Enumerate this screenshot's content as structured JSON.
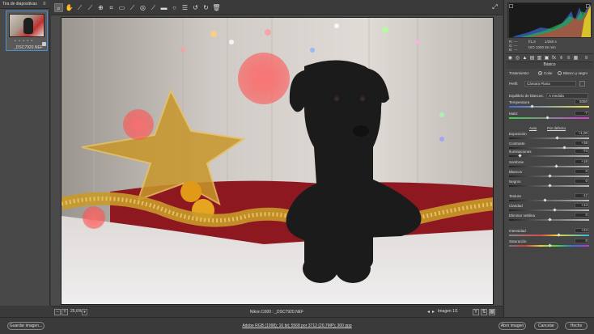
{
  "filmstrip": {
    "title": "Tira de diapositivas",
    "thumb_rating": "• • • • •",
    "thumb_name": "_DSC7920.NEF"
  },
  "toolbar": {
    "tools": [
      "zoom-icon",
      "hand-icon",
      "white-balance-icon",
      "color-sampler-icon",
      "target-adjust-icon",
      "crop-icon",
      "straighten-icon",
      "spot-removal-icon",
      "red-eye-icon",
      "adjustment-brush-icon",
      "graduated-filter-icon",
      "radial-filter-icon",
      "preferences-icon",
      "rotate-ccw-icon",
      "rotate-cw-icon",
      "trash-icon"
    ],
    "fullscreen_icon": "fullscreen-icon"
  },
  "status": {
    "zoom_minus": "−",
    "zoom_plus": "+",
    "zoom": "25,6%",
    "camera_info": "Nikon D300 : _DSC7920.NEF",
    "image_count": "Imagen 1/1"
  },
  "readout": {
    "r_label": "R:",
    "r_value": "---",
    "g_label": "G:",
    "g_value": "---",
    "b_label": "B:",
    "b_value": "---",
    "aperture": "f/1,8",
    "shutter": "1/250 s",
    "iso": "ISO 1000",
    "focal": "35 mm"
  },
  "panel": {
    "title": "Básico",
    "treatment_label": "Tratamiento:",
    "color_label": "Color",
    "bw_label": "Blanco y negro",
    "profile_label": "Perfil:",
    "profile_value": "Cámara Plana",
    "wb_label": "Equilibrio de blancos:",
    "wb_value": "A medida",
    "auto_label": "Auto",
    "default_label": "Por defecto",
    "sliders": [
      {
        "label": "Temperatura",
        "value": "5050",
        "pos": 0.28
      },
      {
        "label": "Matiz",
        "value": "-7",
        "pos": 0.47
      },
      {
        "label": "Exposición",
        "value": "+1,00",
        "pos": 0.6
      },
      {
        "label": "Contraste",
        "value": "+38",
        "pos": 0.69
      },
      {
        "label": "Iluminaciones",
        "value": "-74",
        "pos": 0.13
      },
      {
        "label": "Sombras",
        "value": "+18",
        "pos": 0.59
      },
      {
        "label": "Blancos",
        "value": "0",
        "pos": 0.5
      },
      {
        "label": "Negros",
        "value": "0",
        "pos": 0.5
      },
      {
        "label": "Textura",
        "value": "-12",
        "pos": 0.44
      },
      {
        "label": "Claridad",
        "value": "+14",
        "pos": 0.57
      },
      {
        "label": "Eliminar neblina",
        "value": "0",
        "pos": 0.5
      },
      {
        "label": "Intensidad",
        "value": "+24",
        "pos": 0.62
      },
      {
        "label": "Saturación",
        "value": "0",
        "pos": 0.5
      }
    ]
  },
  "bottom": {
    "save_label": "Guardar imagen...",
    "workflow_link": "Adobe RGB (1998); 16 bit; 5568 por 3712 (20,7MP); 300 ppp",
    "open_label": "Abrir imagen",
    "cancel_label": "Cancelar",
    "done_label": "Hecho"
  },
  "colors": {
    "accent": "#4a8fd8",
    "panel": "#454545",
    "background": "#3a3a3a"
  }
}
